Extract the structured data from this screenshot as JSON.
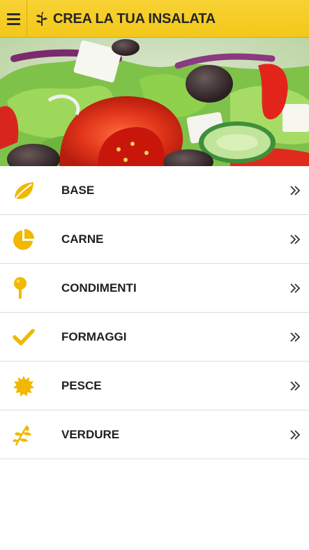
{
  "app": {
    "title": "CREA LA TUA INSALATA",
    "accent_color": "#f3c81a",
    "icon_color": "#f0b900",
    "menu_icon": "hamburger-icon",
    "title_icon": "sprout-icon"
  },
  "hero": {
    "image": "salad-photo"
  },
  "menu": {
    "items": [
      {
        "label": "BASE",
        "icon": "leaf-icon"
      },
      {
        "label": "CARNE",
        "icon": "pie-chart-icon"
      },
      {
        "label": "CONDIMENTI",
        "icon": "pin-icon"
      },
      {
        "label": "FORMAGGI",
        "icon": "checkmark-icon"
      },
      {
        "label": "PESCE",
        "icon": "sun-burst-icon"
      },
      {
        "label": "VERDURE",
        "icon": "herb-icon"
      }
    ],
    "chevron_icon": "double-chevron-right-icon"
  }
}
